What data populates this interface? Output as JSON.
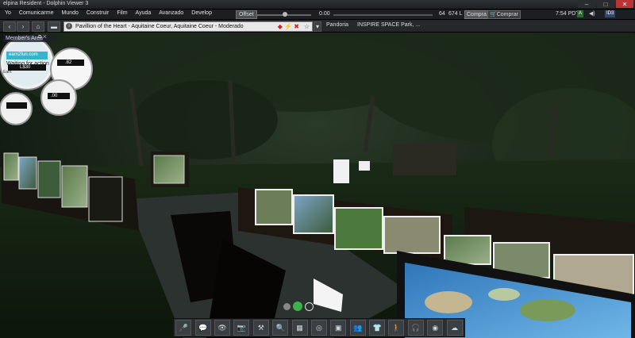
{
  "window": {
    "title": "elpina Resident - Dolphin Viewer 3"
  },
  "menu": {
    "items": [
      "Yo",
      "Comunicarme",
      "Mundo",
      "Construir",
      "Film",
      "Ayuda",
      "Avanzado",
      "Develop"
    ]
  },
  "status": {
    "offset_label": "Offset",
    "value_left": "0.00",
    "value_right": "64",
    "balance": "674 L",
    "buy_button": "Compra",
    "buy_button2": "Comprar",
    "time": "7:54 PDT",
    "badge_a": "A",
    "badge_id": "ID3"
  },
  "nav": {
    "location": "Pavillion of the Heart - Aquitaine Coeur, Aquitaine Coeur - Moderado",
    "favorites": [
      "Pandoria",
      "INSPIRE SPACE Park, ..."
    ]
  },
  "side_panel": {
    "title": "Member's Area"
  },
  "bubbles": {
    "b1_line1": "earn2fun.com",
    "b1_line2": "Waiting for action",
    "b1_line3": "Earn",
    "b1_value": "L$30",
    "b2_value": ".82",
    "b3_value": ".00"
  },
  "toolbar": {
    "buttons": [
      {
        "name": "speak-icon",
        "glyph": "🎤"
      },
      {
        "name": "chat-icon",
        "glyph": "💬"
      },
      {
        "name": "view-icon",
        "glyph": "👁"
      },
      {
        "name": "snapshot-icon",
        "glyph": "📷"
      },
      {
        "name": "build-icon",
        "glyph": "⚒"
      },
      {
        "name": "search-icon",
        "glyph": "🔍"
      },
      {
        "name": "map-icon",
        "glyph": "▦"
      },
      {
        "name": "minimap-icon",
        "glyph": "◎"
      },
      {
        "name": "inventory-icon",
        "glyph": "▣"
      },
      {
        "name": "people-icon",
        "glyph": "👥"
      },
      {
        "name": "appearance-icon",
        "glyph": "👕"
      },
      {
        "name": "move-icon",
        "glyph": "🚶"
      },
      {
        "name": "voice-icon",
        "glyph": "🎧"
      },
      {
        "name": "radar-icon",
        "glyph": "◉"
      },
      {
        "name": "environment-icon",
        "glyph": "☁"
      }
    ]
  },
  "colors": {
    "accent": "#d33a3a",
    "toolbar_bg": "#2b2f33",
    "scene_bg": "#0b120d"
  }
}
